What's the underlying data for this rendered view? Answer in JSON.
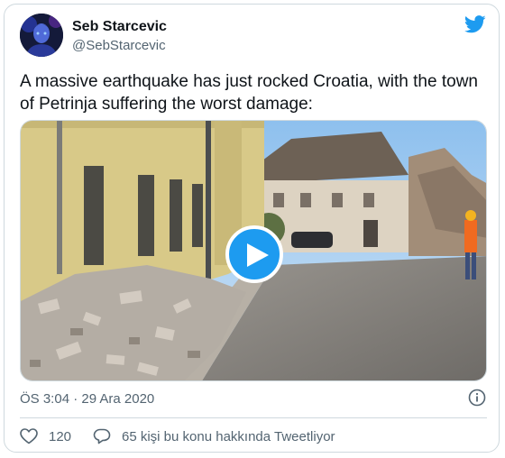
{
  "tweet": {
    "author_name": "Seb Starcevic",
    "author_handle": "@SebStarcevic",
    "text": "A massive earthquake has just rocked Croatia, with the town of Petrinja suffering the worst damage:",
    "timestamp": "ÖS 3:04 · 29 Ara 2020",
    "likes_count": "120",
    "talking_text": "65 kişi bu konu hakkında Tweetliyor"
  },
  "icons": {
    "brand": "twitter-bird-icon",
    "play": "play-icon",
    "info": "info-icon",
    "like": "heart-icon",
    "reply": "reply-bubble-icon"
  },
  "colors": {
    "accent": "#1d9bf0",
    "secondary_text": "#536471",
    "border": "#cfd9de"
  }
}
